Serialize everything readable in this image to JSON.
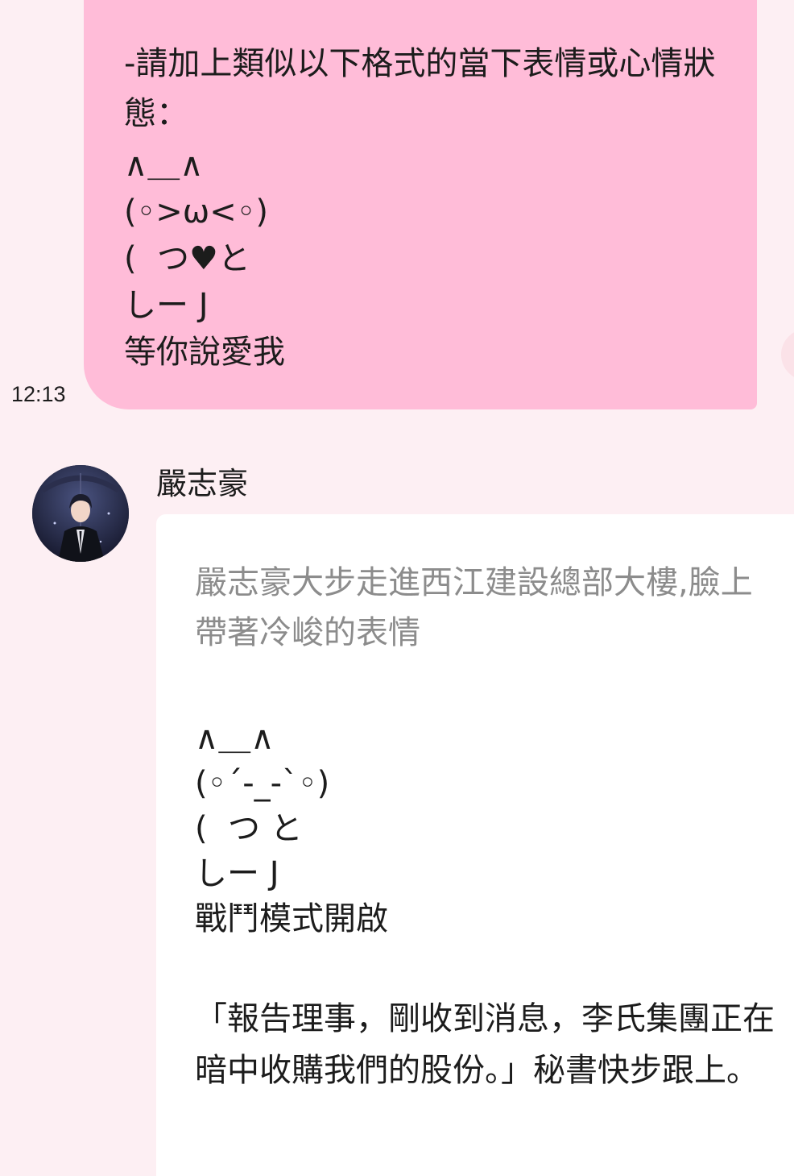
{
  "sent_message": {
    "text_lines": [
      "-請加上類似以下格式的當下表情或心情狀態：",
      "∧＿∧",
      "(◦>ω<◦)",
      "(  つ♥と",
      "しー J",
      "等你說愛我"
    ],
    "time": "12:13"
  },
  "received_message": {
    "sender_name": "嚴志豪",
    "avatar_icon": "character-portrait-avatar",
    "narration": "嚴志豪大步走進西江建設總部大樓,臉上帶著冷峻的表情",
    "kaomoji_lines": [
      "∧＿∧",
      "(◦´-_-`◦)",
      "(  つ と",
      "しー J",
      "戰鬥模式開啟"
    ],
    "dialogue": "「報告理事，剛收到消息，李氏集團正在暗中收購我們的股份。」秘書快步跟上。"
  },
  "colors": {
    "background": "#fdeff3",
    "sent_bubble": "#ffbcd8",
    "received_bubble": "#ffffff",
    "narration_text": "#8c8c8c",
    "text": "#1c1c1c"
  }
}
